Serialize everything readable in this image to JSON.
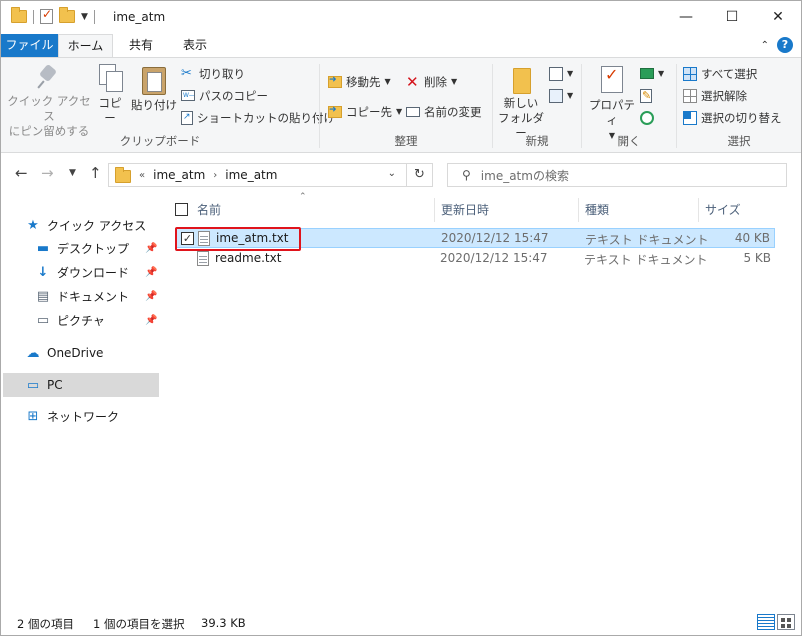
{
  "window": {
    "title": "ime_atm",
    "controls": {
      "minimize": "—",
      "maximize": "☐",
      "close": "✕"
    }
  },
  "ribbon_tabs": [
    {
      "label": "ファイル"
    },
    {
      "label": "ホーム"
    },
    {
      "label": "共有"
    },
    {
      "label": "表示"
    }
  ],
  "ribbon": {
    "clipboard": {
      "group_label": "クリップボード",
      "pin_line1": "クイック アクセス",
      "pin_line2": "にピン留めする",
      "copy": "コピー",
      "paste": "貼り付け",
      "cut": "切り取り",
      "copy_path": "パスのコピー",
      "paste_shortcut": "ショートカットの貼り付け"
    },
    "organize": {
      "group_label": "整理",
      "move_to": "移動先",
      "copy_to": "コピー先",
      "delete": "削除",
      "rename": "名前の変更"
    },
    "new": {
      "group_label": "新規",
      "new_folder_line1": "新しい",
      "new_folder_line2": "フォルダー"
    },
    "open": {
      "group_label": "開く",
      "properties": "プロパティ"
    },
    "select": {
      "group_label": "選択",
      "select_all": "すべて選択",
      "select_none": "選択解除",
      "invert": "選択の切り替え"
    }
  },
  "address_bar": {
    "overflow": "«",
    "parts": [
      "ime_atm",
      "ime_atm"
    ]
  },
  "search": {
    "placeholder": "ime_atmの検索"
  },
  "nav_pane": {
    "quick_access": "クイック アクセス",
    "items": [
      {
        "label": "デスクトップ",
        "icon": "desktop-icon"
      },
      {
        "label": "ダウンロード",
        "icon": "download-icon"
      },
      {
        "label": "ドキュメント",
        "icon": "documents-icon"
      },
      {
        "label": "ピクチャ",
        "icon": "pictures-icon"
      }
    ],
    "onedrive": "OneDrive",
    "pc": "PC",
    "network": "ネットワーク"
  },
  "columns": {
    "name": "名前",
    "modified": "更新日時",
    "type": "種類",
    "size": "サイズ"
  },
  "files": [
    {
      "name": "ime_atm.txt",
      "modified": "2020/12/12 15:47",
      "type": "テキスト ドキュメント",
      "size": "40 KB",
      "selected": true
    },
    {
      "name": "readme.txt",
      "modified": "2020/12/12 15:47",
      "type": "テキスト ドキュメント",
      "size": "5 KB",
      "selected": false
    }
  ],
  "status": {
    "item_count": "2 個の項目",
    "selection": "1 個の項目を選択",
    "selection_size": "39.3 KB"
  },
  "colors": {
    "accent": "#1979ca",
    "selection_bg": "#cce8ff",
    "highlight_border": "#e0141c"
  }
}
